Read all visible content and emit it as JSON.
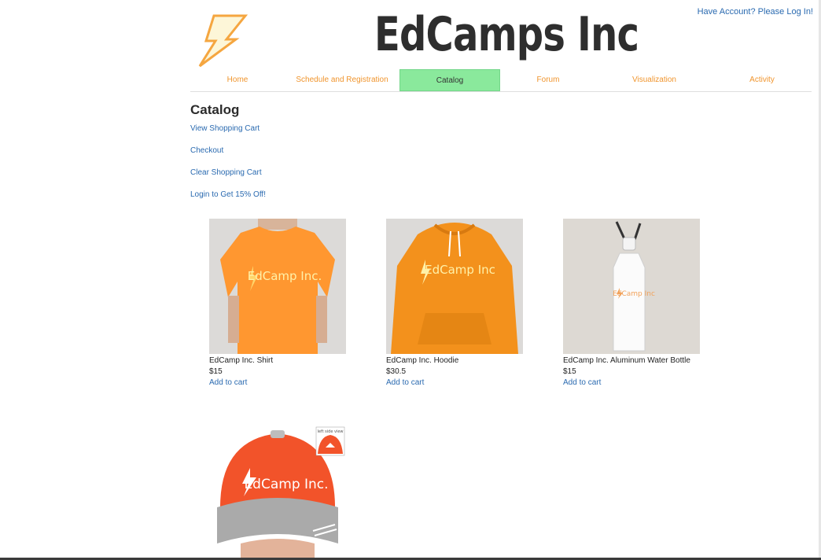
{
  "header": {
    "login_link": "Have Account? Please Log In!",
    "brand": "EdCamps Inc"
  },
  "nav": {
    "items": [
      {
        "label": "Home"
      },
      {
        "label": "Schedule and Registration"
      },
      {
        "label": "Catalog"
      },
      {
        "label": "Forum"
      },
      {
        "label": "Visualization"
      },
      {
        "label": "Activity"
      }
    ],
    "active": "Catalog",
    "active_color": "#8ae99c",
    "link_color": "#f0952e"
  },
  "catalog": {
    "title": "Catalog",
    "links": {
      "view_cart": "View Shopping Cart",
      "checkout": "Checkout",
      "clear_cart": "Clear Shopping Cart",
      "login_discount": "Login to Get 15% Off!"
    }
  },
  "products": [
    {
      "name": "EdCamp Inc. Shirt",
      "price": "$15",
      "add": "Add to cart",
      "print": "EdCamp Inc.",
      "color": "#ff9730"
    },
    {
      "name": "EdCamp Inc. Hoodie",
      "price": "$30.5",
      "add": "Add to cart",
      "print": "EdCamp Inc",
      "color": "#f3911c"
    },
    {
      "name": "EdCamp Inc. Aluminum Water Bottle",
      "price": "$15",
      "add": "Add to cart",
      "print": "EdCamp Inc",
      "color": "#ffffff"
    },
    {
      "name": "",
      "price": "",
      "add": "",
      "print": "EdCamp Inc.",
      "badge": "left side view",
      "color": "#f2532a"
    }
  ],
  "colors": {
    "link": "#2a6ab0",
    "accent_orange": "#f0952e",
    "logo_bolt": "#f5a640"
  }
}
